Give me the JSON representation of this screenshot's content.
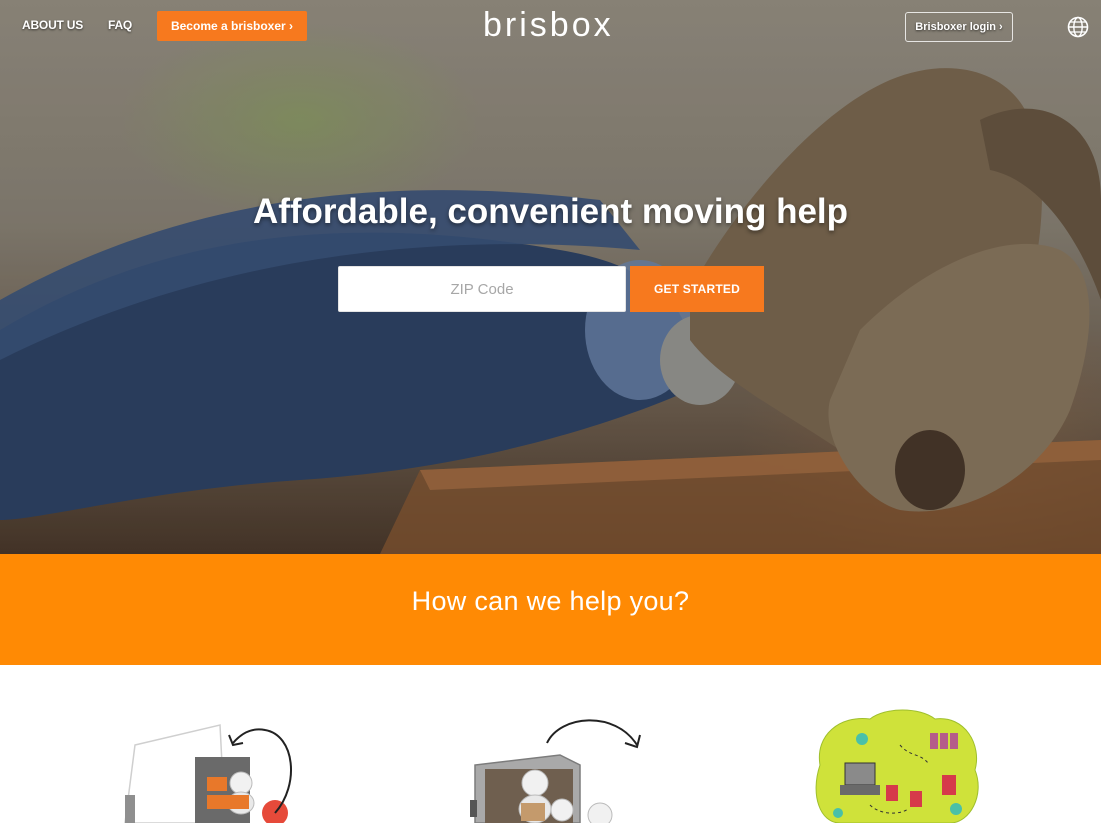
{
  "nav": {
    "about_label": "ABOUT US",
    "faq_label": "FAQ",
    "become_label": "Become a brisboxer ›",
    "logo_text": "brisbox",
    "login_label": "Brisboxer login ›",
    "globe_icon": "globe-icon"
  },
  "hero": {
    "headline": "Affordable, convenient moving help",
    "zip_placeholder": "ZIP Code",
    "zip_value": "",
    "cta_label": "GET STARTED"
  },
  "band": {
    "title": "How can we help you?"
  },
  "services": {
    "items": [
      {
        "icon": "truck-unload-icon"
      },
      {
        "icon": "storage-unit-icon"
      },
      {
        "icon": "furniture-arrange-icon"
      }
    ]
  },
  "colors": {
    "accent": "#f7791e",
    "band": "#ff8a04"
  }
}
